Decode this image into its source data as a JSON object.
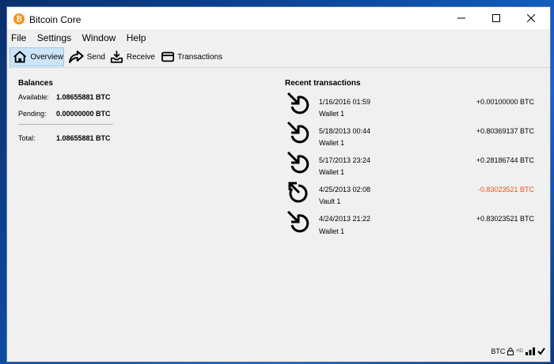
{
  "window": {
    "title": "Bitcoin Core",
    "app_icon_glyph": "₿"
  },
  "menu": [
    "File",
    "Settings",
    "Window",
    "Help"
  ],
  "toolbar": {
    "overview": "Overview",
    "send": "Send",
    "receive": "Receive",
    "transactions": "Transactions"
  },
  "balances": {
    "title": "Balances",
    "available_label": "Available:",
    "available_value": "1.08655881 BTC",
    "pending_label": "Pending:",
    "pending_value": "0.00000000 BTC",
    "total_label": "Total:",
    "total_value": "1.08655881 BTC"
  },
  "recent": {
    "title": "Recent transactions",
    "items": [
      {
        "date": "1/16/2016 01:59",
        "label": "Wallet 1",
        "amount": "+0.00100000 BTC",
        "direction": "incoming"
      },
      {
        "date": "5/18/2013 00:44",
        "label": "Wallet 1",
        "amount": "+0.80369137 BTC",
        "direction": "incoming"
      },
      {
        "date": "5/17/2013 23:24",
        "label": "Wallet 1",
        "amount": "+0.28186744 BTC",
        "direction": "incoming"
      },
      {
        "date": "4/25/2013 02:08",
        "label": "Vault 1",
        "amount": "-0.83023521 BTC",
        "direction": "outgoing"
      },
      {
        "date": "4/24/2013 21:22",
        "label": "Wallet 1",
        "amount": "+0.83023521 BTC",
        "direction": "incoming"
      }
    ]
  },
  "status": {
    "unit": "BTC",
    "hd_label": "HD"
  },
  "colors": {
    "negative_amount": "#e8521c",
    "active_tab_bg": "#cde4f7",
    "bitcoin_orange": "#f7931a"
  }
}
